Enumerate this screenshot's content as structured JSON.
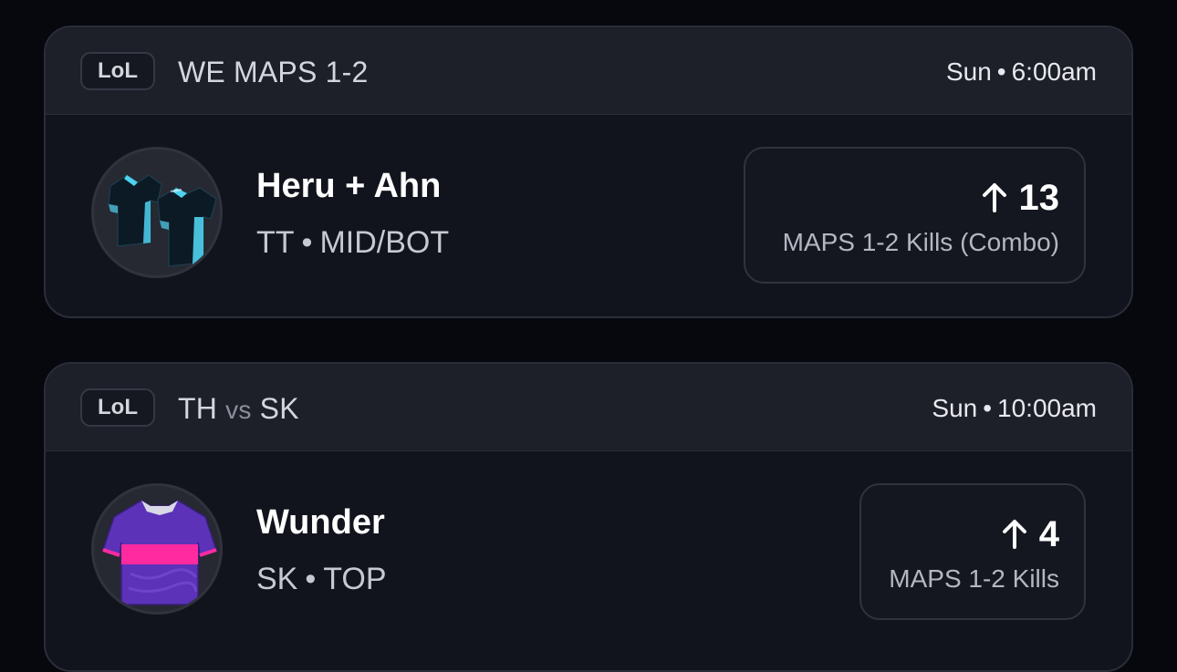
{
  "cards": [
    {
      "game_badge": "LoL",
      "match_title": "WE MAPS 1-2",
      "day": "Sun",
      "time": "6:00am",
      "avatar_icon": "jersey-pair-icon",
      "player_name": "Heru + Ahn",
      "team": "TT",
      "position": "MID/BOT",
      "line_direction_icon": "arrow-up-icon",
      "line_value": "13",
      "stat_label": "MAPS 1-2 Kills (Combo)"
    },
    {
      "game_badge": "LoL",
      "team_a": "TH",
      "vs": "vs",
      "team_b": "SK",
      "day": "Sun",
      "time": "10:00am",
      "avatar_icon": "jersey-icon",
      "player_name": "Wunder",
      "team": "SK",
      "position": "TOP",
      "line_direction_icon": "arrow-up-icon",
      "line_value": "4",
      "stat_label": "MAPS 1-2 Kills"
    }
  ],
  "separator": "•",
  "colors": {
    "background": "#07080e",
    "card": "#12141d",
    "card_header": "#1d1f29",
    "jersey_tt_primary": "#0b1a24",
    "jersey_tt_accent": "#4fd2f0",
    "jersey_sk_primary": "#5b32b8",
    "jersey_sk_stripe": "#ff2aa0"
  }
}
